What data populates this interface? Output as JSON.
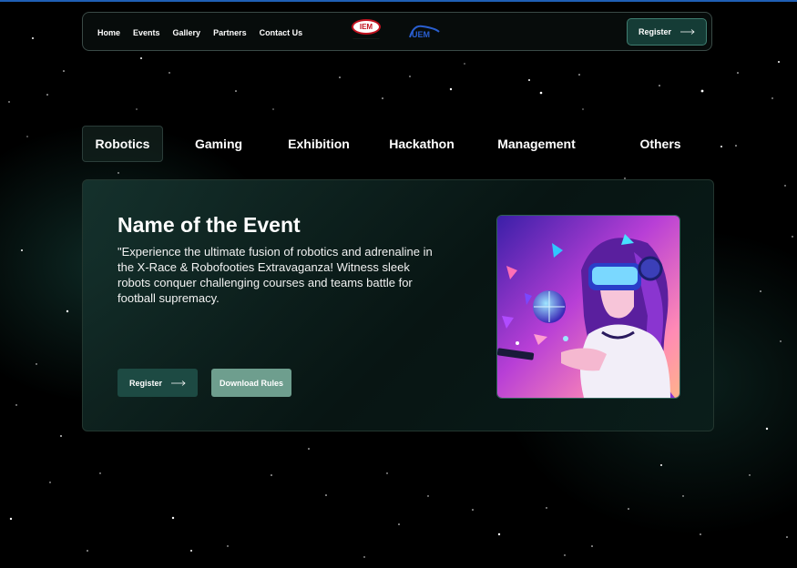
{
  "nav": {
    "links": [
      "Home",
      "Events",
      "Gallery",
      "Partners",
      "Contact Us"
    ],
    "logo_iem": "IEM",
    "logo_uem": "UEM",
    "register_label": "Register"
  },
  "tabs": [
    "Robotics",
    "Gaming",
    "Exhibition",
    "Hackathon",
    "Management",
    "Others"
  ],
  "active_tab": "Robotics",
  "event": {
    "title": "Name of the Event",
    "description": "\"Experience the ultimate fusion of robotics and adrenaline in the X-Race & Robofooties Extravaganza! Witness sleek robots conquer challenging courses and teams battle for football supremacy.",
    "register_label": "Register",
    "download_label": "Download Rules",
    "image_icon": "vr-headset-girl-illustration"
  },
  "colors": {
    "accent": "#153c36",
    "download_button": "#6e9e8e",
    "topline": "#1f5fb5"
  }
}
